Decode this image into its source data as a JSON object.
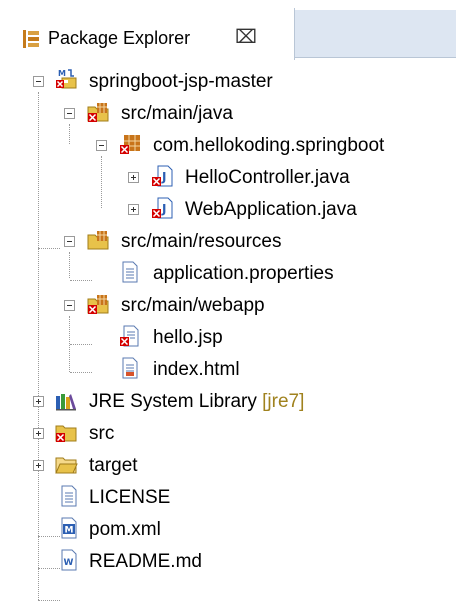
{
  "view": {
    "title": "Package Explorer",
    "close_glyph": "⌧",
    "icon": "package-explorer-icon"
  },
  "tree": {
    "project": {
      "label": "springboot-jsp-master",
      "icon": "maven-project-error-icon"
    },
    "src_main_java": {
      "label": "src/main/java",
      "icon": "source-folder-error-icon"
    },
    "package": {
      "label": "com.hellokoding.springboot",
      "icon": "package-error-icon"
    },
    "hello_controller": {
      "label": "HelloController.java",
      "icon": "java-file-error-icon"
    },
    "web_application": {
      "label": "WebApplication.java",
      "icon": "java-file-error-icon"
    },
    "src_main_resources": {
      "label": "src/main/resources",
      "icon": "source-folder-icon"
    },
    "application_properties": {
      "label": "application.properties",
      "icon": "text-file-icon"
    },
    "src_main_webapp": {
      "label": "src/main/webapp",
      "icon": "source-folder-error-icon"
    },
    "hello_jsp": {
      "label": "hello.jsp",
      "icon": "jsp-file-error-icon"
    },
    "index_html": {
      "label": "index.html",
      "icon": "html-file-icon"
    },
    "jre_library": {
      "label": "JRE System Library",
      "decoration": "[jre7]",
      "icon": "library-icon"
    },
    "src": {
      "label": "src",
      "icon": "folder-error-icon"
    },
    "target": {
      "label": "target",
      "icon": "folder-icon"
    },
    "license": {
      "label": "LICENSE",
      "icon": "text-file-icon"
    },
    "pom": {
      "label": "pom.xml",
      "icon": "maven-pom-icon"
    },
    "readme": {
      "label": "README.md",
      "icon": "markdown-file-icon"
    }
  },
  "colors": {
    "error": "#d40000",
    "folder": "#e8c24a",
    "package": "#c8741a",
    "java": "#2c5fb3",
    "decoration": "#a0821e"
  }
}
